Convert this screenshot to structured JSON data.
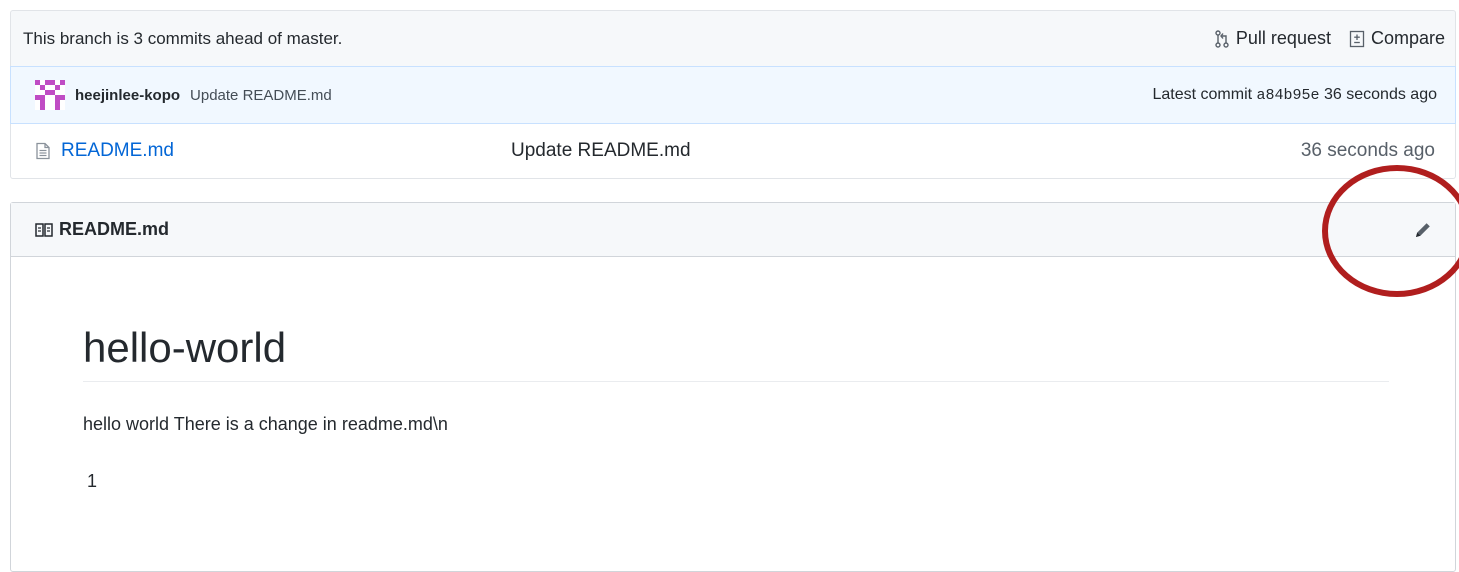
{
  "branch_bar": {
    "status_text": "This branch is 3 commits ahead of master.",
    "pull_request_label": "Pull request",
    "compare_label": "Compare"
  },
  "commit_bar": {
    "author": "heejinlee-kopo",
    "message": "Update README.md",
    "latest_commit_label": "Latest commit",
    "sha": "a84b95e",
    "time_ago": "36 seconds ago"
  },
  "files": [
    {
      "name": "README.md",
      "message": "Update README.md",
      "age": "36 seconds ago"
    }
  ],
  "readme": {
    "header_title": "README.md",
    "heading": "hello-world",
    "paragraph": "hello world There is a change in readme.md\\n",
    "paragraph2": "1"
  },
  "colors": {
    "link": "#0366d6",
    "annotation": "#b01e1e",
    "commit_bg": "#f1f8ff"
  },
  "icons": [
    "pull-request-icon",
    "compare-icon",
    "avatar",
    "file-icon",
    "book-icon",
    "pencil-icon"
  ]
}
